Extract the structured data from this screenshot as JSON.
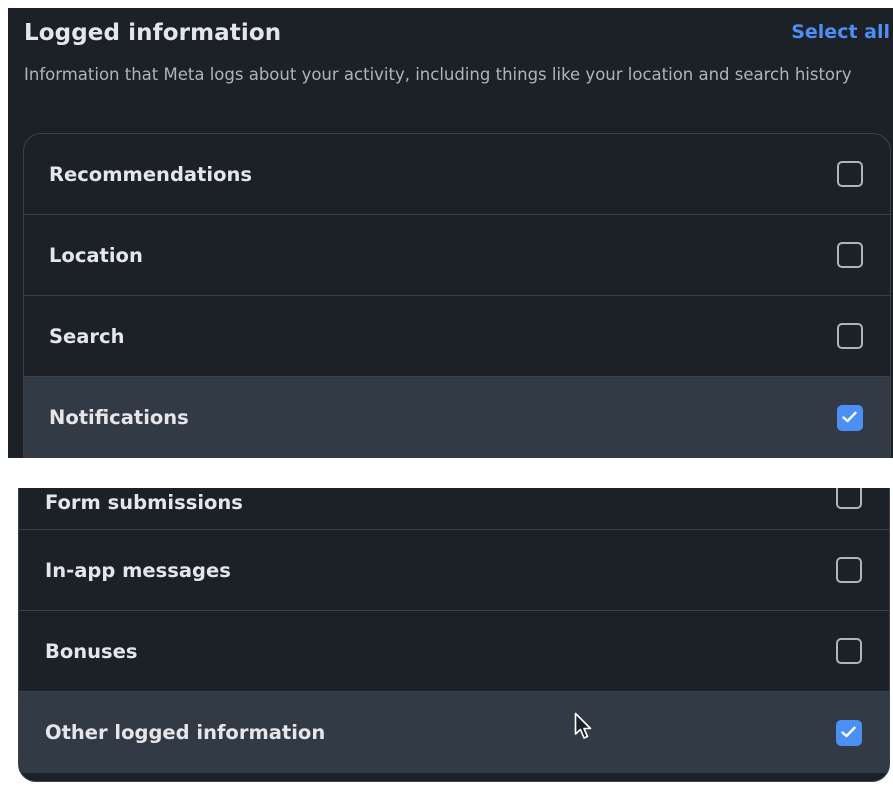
{
  "header": {
    "title": "Logged information",
    "select_all": "Select all",
    "description": "Information that Meta logs about your activity, including things like your location and search history"
  },
  "items_top": [
    {
      "label": "Recommendations",
      "checked": false
    },
    {
      "label": "Location",
      "checked": false
    },
    {
      "label": "Search",
      "checked": false
    },
    {
      "label": "Notifications",
      "checked": true
    }
  ],
  "items_bottom": [
    {
      "label": "Form submissions",
      "checked": false
    },
    {
      "label": "In-app messages",
      "checked": false
    },
    {
      "label": "Bonuses",
      "checked": false
    },
    {
      "label": "Other logged information",
      "checked": true
    }
  ],
  "colors": {
    "accent": "#4c8ff5",
    "background": "#1c2128",
    "selected_row": "#323a45"
  },
  "icons": {
    "checkbox_checked": "checkmark-icon",
    "cursor": "mouse-pointer-icon"
  }
}
